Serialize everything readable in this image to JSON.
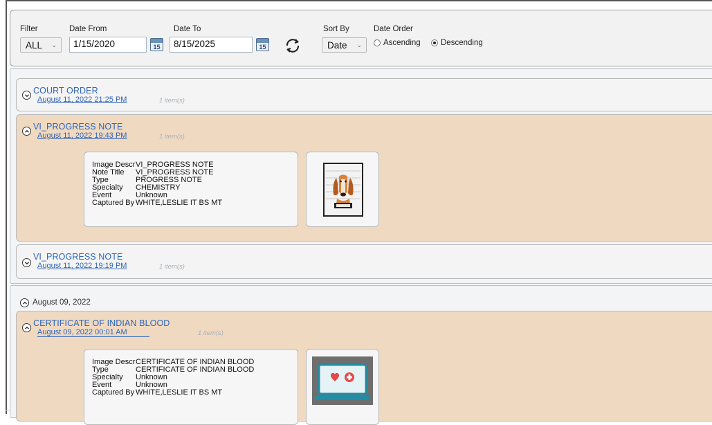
{
  "filter": {
    "filter_label": "Filter",
    "filter_value": "ALL",
    "date_from_label": "Date From",
    "date_from_value": "1/15/2020",
    "date_to_label": "Date To",
    "date_to_value": "8/15/2025",
    "calendar_day": "15",
    "sort_by_label": "Sort By",
    "sort_by_value": "Date",
    "date_order_label": "Date Order",
    "ascending_label": "Ascending",
    "descending_label": "Descending",
    "selected_order": "Descending"
  },
  "documents": [
    {
      "title": "COURT ORDER",
      "date": "August 11, 2022 21:25 PM",
      "count": "1 item(s)",
      "expanded": false
    },
    {
      "title": "VI_PROGRESS NOTE",
      "date": "August 11, 2022 19:43 PM",
      "count": "1 item(s)",
      "expanded": true,
      "details": [
        {
          "key": "Image Descr",
          "value": "VI_PROGRESS NOTE"
        },
        {
          "key": "Note Title",
          "value": "VI_PROGRESS NOTE"
        },
        {
          "key": "Type",
          "value": "PROGRESS NOTE"
        },
        {
          "key": "Specialty",
          "value": "CHEMISTRY"
        },
        {
          "key": "Event",
          "value": "Unknown"
        },
        {
          "key": "Captured By",
          "value": "WHITE,LESLIE IT BS MT"
        }
      ],
      "thumbnail_icon": "dog-mugshot-icon"
    },
    {
      "title": "VI_PROGRESS NOTE",
      "date": "August 11, 2022 19:19 PM",
      "count": "1 item(s)",
      "expanded": false
    }
  ],
  "group": {
    "label": "August 09, 2022",
    "document": {
      "title": "CERTIFICATE OF INDIAN BLOOD",
      "date": "August 09, 2022 00:01 AM",
      "count": "1 item(s)",
      "details": [
        {
          "key": "Image Descr",
          "value": "CERTIFICATE OF INDIAN BLOOD"
        },
        {
          "key": "Type",
          "value": "CERTIFICATE OF INDIAN BLOOD"
        },
        {
          "key": "Specialty",
          "value": "Unknown"
        },
        {
          "key": "Event",
          "value": "Unknown"
        },
        {
          "key": "Captured By",
          "value": "WHITE,LESLIE IT BS MT"
        }
      ],
      "thumbnail_icon": "medical-laptop-icon"
    }
  },
  "colors": {
    "link": "#2e66b8",
    "expanded_bg": "#f0d9c1",
    "panel_bg": "#f2f2f2"
  }
}
